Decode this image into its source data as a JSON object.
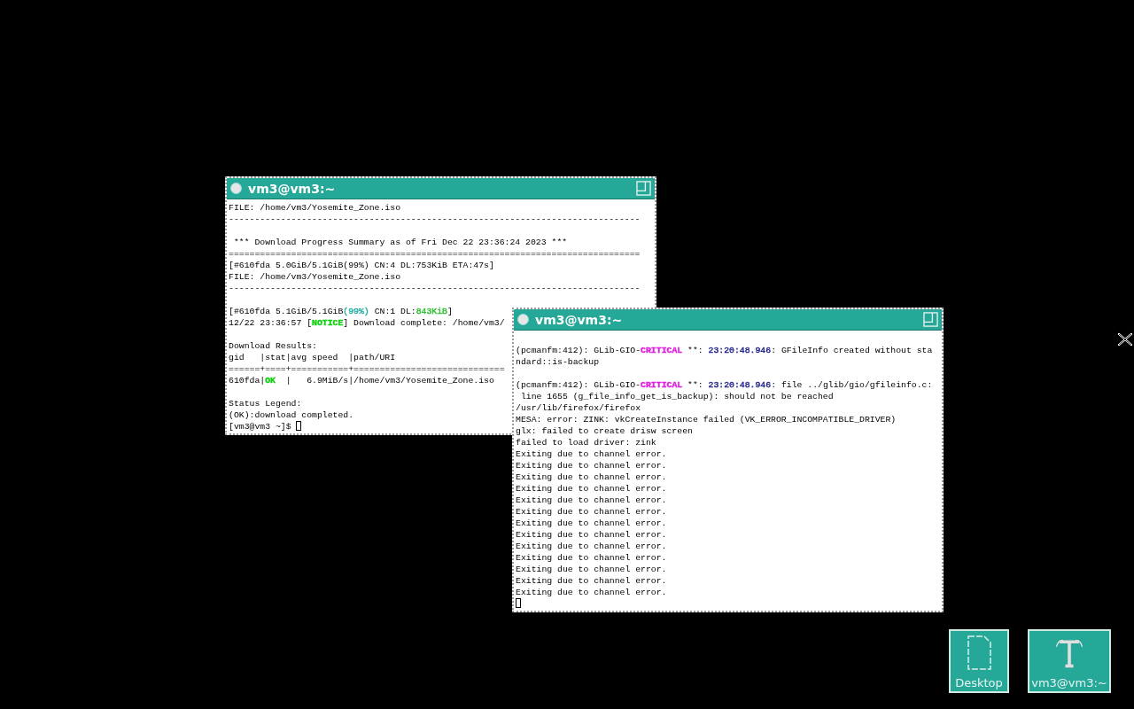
{
  "windows": [
    {
      "title": "vm3@vm3:~",
      "lines": [
        {
          "kind": "text",
          "text": "FILE: /home/vm3/Yosemite_Zone.iso"
        },
        {
          "kind": "text",
          "text": "-------------------------------------------------------------------------------"
        },
        {
          "kind": "blank"
        },
        {
          "kind": "text",
          "text": " *** Download Progress Summary as of Fri Dec 22 23:36:24 2023 ***"
        },
        {
          "kind": "text",
          "text": "==============================================================================="
        },
        {
          "kind": "text",
          "text": "[#610fda 5.0GiB/5.1GiB(99%) CN:4 DL:753KiB ETA:47s]"
        },
        {
          "kind": "text",
          "text": "FILE: /home/vm3/Yosemite_Zone.iso"
        },
        {
          "kind": "text",
          "text": "-------------------------------------------------------------------------------"
        },
        {
          "kind": "blank"
        },
        {
          "kind": "rich",
          "segments": [
            {
              "text": "[#610fda 5.1GiB/5.1GiB"
            },
            {
              "text": "(99%)",
              "color": "#20b0a0"
            },
            {
              "text": " CN:1 DL:"
            },
            {
              "text": "843KiB",
              "color": "#30c030"
            },
            {
              "text": "]"
            }
          ]
        },
        {
          "kind": "rich",
          "segments": [
            {
              "text": "12/22 23:36:57 ["
            },
            {
              "text": "NOTICE",
              "color": "#10d010",
              "bold": true
            },
            {
              "text": "] Download complete: /home/vm3/"
            }
          ]
        },
        {
          "kind": "blank"
        },
        {
          "kind": "text",
          "text": "Download Results:"
        },
        {
          "kind": "text",
          "text": "gid   |stat|avg speed  |path/URI"
        },
        {
          "kind": "text",
          "text": "======+====+===========+============================="
        },
        {
          "kind": "rich",
          "segments": [
            {
              "text": "610fda|"
            },
            {
              "text": "OK",
              "color": "#10d010",
              "bold": true
            },
            {
              "text": "  |   6.9MiB/s|/home/vm3/Yosemite_Zone.iso"
            }
          ]
        },
        {
          "kind": "blank"
        },
        {
          "kind": "text",
          "text": "Status Legend:"
        },
        {
          "kind": "text",
          "text": "(OK):download completed."
        },
        {
          "kind": "rich",
          "segments": [
            {
              "text": "[vm3@vm3 ~]$ "
            },
            {
              "kind": "cursor"
            }
          ]
        }
      ]
    },
    {
      "title": "vm3@vm3:~",
      "lines": [
        {
          "kind": "blank"
        },
        {
          "kind": "rich",
          "segments": [
            {
              "text": "(pcmanfm:412): GLib-GIO-"
            },
            {
              "text": "CRITICAL",
              "color": "#e020e0",
              "bold": true
            },
            {
              "text": " **: "
            },
            {
              "text": "23:20:48.946",
              "color": "#202090"
            },
            {
              "text": ": GFileInfo created without sta"
            }
          ]
        },
        {
          "kind": "text",
          "text": "ndard::is-backup"
        },
        {
          "kind": "blank"
        },
        {
          "kind": "rich",
          "segments": [
            {
              "text": "(pcmanfm:412): GLib-GIO-"
            },
            {
              "text": "CRITICAL",
              "color": "#e020e0",
              "bold": true
            },
            {
              "text": " **: "
            },
            {
              "text": "23:20:48.946",
              "color": "#202090"
            },
            {
              "text": ": file ../glib/gio/gfileinfo.c:"
            }
          ]
        },
        {
          "kind": "text",
          "text": " line 1655 (g_file_info_get_is_backup): should not be reached"
        },
        {
          "kind": "text",
          "text": "/usr/lib/firefox/firefox"
        },
        {
          "kind": "text",
          "text": "MESA: error: ZINK: vkCreateInstance failed (VK_ERROR_INCOMPATIBLE_DRIVER)"
        },
        {
          "kind": "text",
          "text": "glx: failed to create drisw screen"
        },
        {
          "kind": "text",
          "text": "failed to load driver: zink"
        },
        {
          "kind": "text",
          "text": "Exiting due to channel error."
        },
        {
          "kind": "text",
          "text": "Exiting due to channel error."
        },
        {
          "kind": "text",
          "text": "Exiting due to channel error."
        },
        {
          "kind": "text",
          "text": "Exiting due to channel error."
        },
        {
          "kind": "text",
          "text": "Exiting due to channel error."
        },
        {
          "kind": "text",
          "text": "Exiting due to channel error."
        },
        {
          "kind": "text",
          "text": "Exiting due to channel error."
        },
        {
          "kind": "text",
          "text": "Exiting due to channel error."
        },
        {
          "kind": "text",
          "text": "Exiting due to channel error."
        },
        {
          "kind": "text",
          "text": "Exiting due to channel error."
        },
        {
          "kind": "text",
          "text": "Exiting due to channel error."
        },
        {
          "kind": "text",
          "text": "Exiting due to channel error."
        },
        {
          "kind": "text",
          "text": "Exiting due to channel error."
        },
        {
          "kind": "rich",
          "segments": [
            {
              "kind": "cursor"
            }
          ]
        }
      ]
    }
  ],
  "desktop_icons": [
    {
      "kind": "file",
      "label": "Desktop"
    },
    {
      "kind": "terminal",
      "label": "vm3@vm3:~"
    }
  ]
}
